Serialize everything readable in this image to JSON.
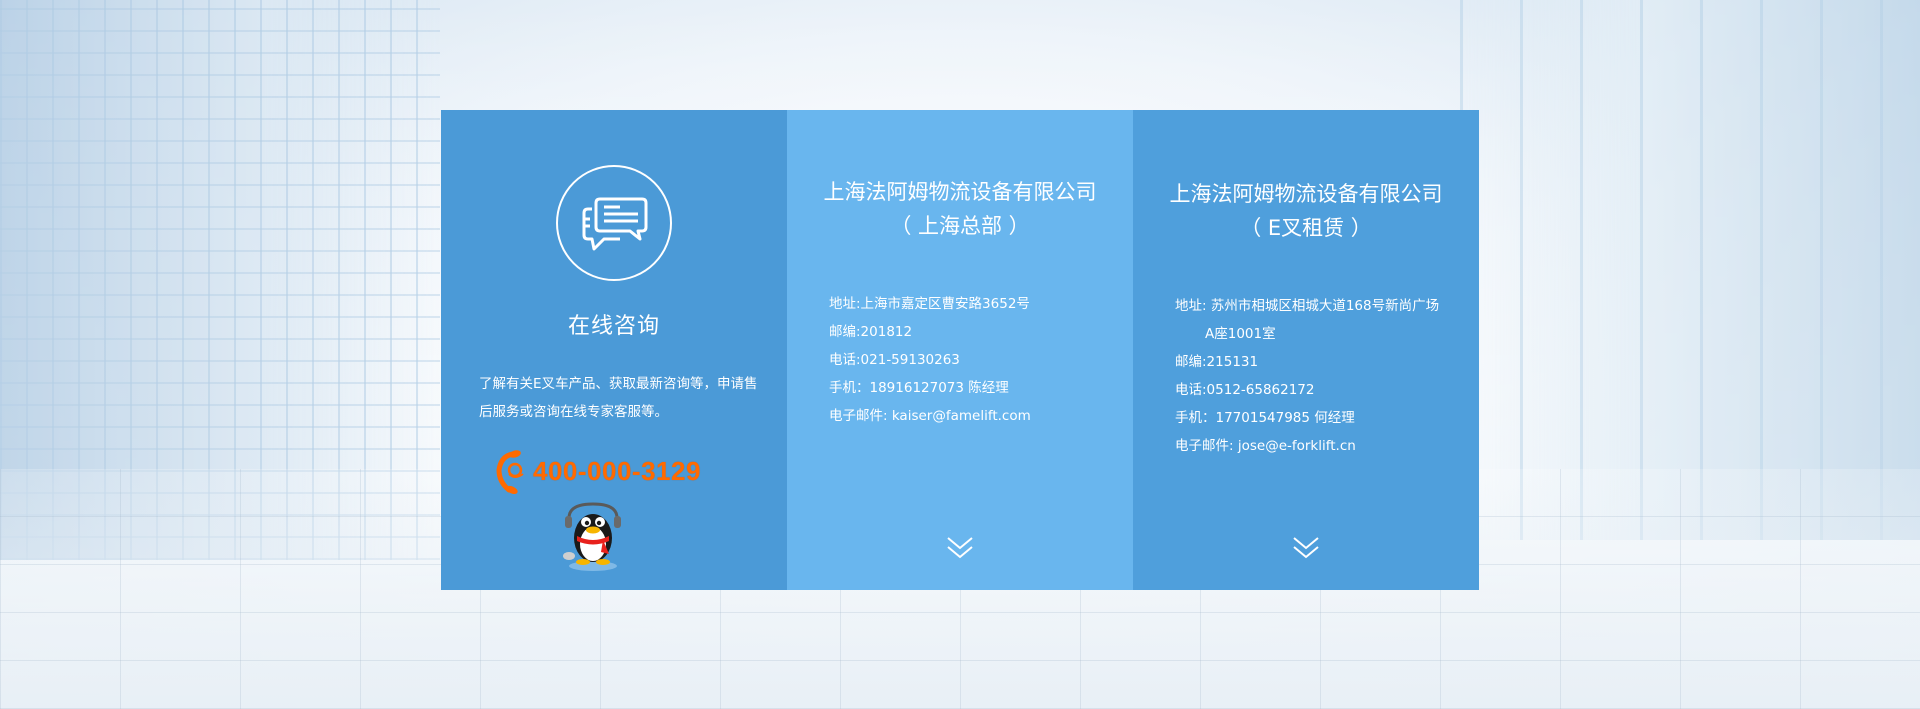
{
  "colors": {
    "panel_left": "#4b9ad7",
    "panel_middle": "#69b6ee",
    "panel_right": "#4f9fdc",
    "hotline": "#ff6a00",
    "text": "#ffffff"
  },
  "consult": {
    "icon": "chat-bubbles-icon",
    "title": "在线咨询",
    "description": "了解有关E叉车产品、获取最新咨询等，申请售后服务或咨询在线专家客服等。",
    "hotline_icon": "phone-icon",
    "hotline": "400-000-3129",
    "qq_icon": "qq-penguin-icon"
  },
  "shanghai": {
    "company": "上海法阿姆物流设备有限公司",
    "branch": "（ 上海总部 ）",
    "address": "地址:上海市嘉定区曹安路3652号",
    "postcode": "邮编:201812",
    "phone": "电话:021-59130263",
    "mobile": "手机：18916127073 陈经理",
    "email": "电子邮件: kaiser@famelift.com",
    "more_icon": "double-chevron-down-icon"
  },
  "suzhou": {
    "company": "上海法阿姆物流设备有限公司",
    "branch": "（ E叉租赁 ）",
    "address": "地址: 苏州市相城区相城大道168号新尚广场",
    "address_line2": "A座1001室",
    "postcode": "邮编:215131",
    "phone": "电话:0512-65862172",
    "mobile": "手机：17701547985 何经理",
    "email": "电子邮件: jose@e-forklift.cn",
    "more_icon": "double-chevron-down-icon"
  }
}
